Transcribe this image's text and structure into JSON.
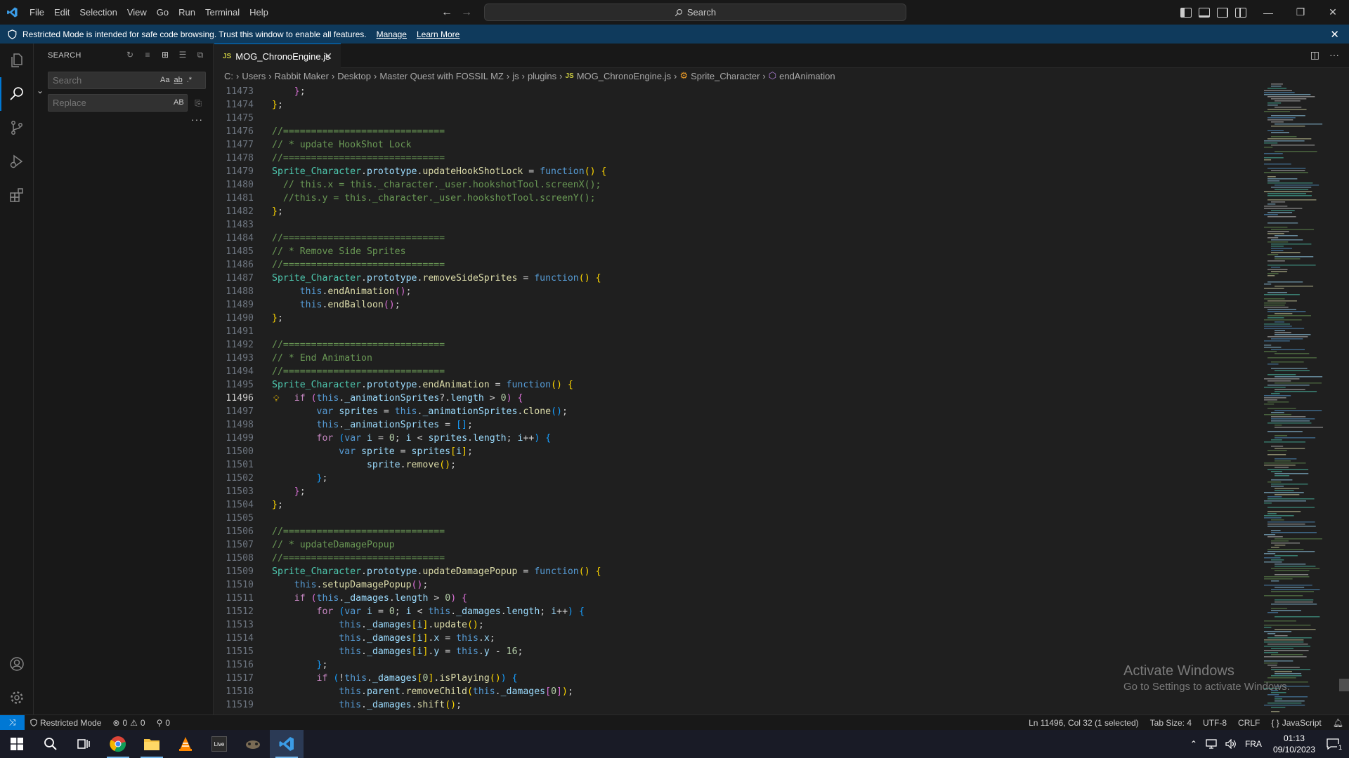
{
  "menu": [
    "File",
    "Edit",
    "Selection",
    "View",
    "Go",
    "Run",
    "Terminal",
    "Help"
  ],
  "title_search": "Search",
  "banner": {
    "text": "Restricted Mode is intended for safe code browsing. Trust this window to enable all features.",
    "manage": "Manage",
    "learn_more": "Learn More"
  },
  "sidebar": {
    "title": "SEARCH",
    "search_placeholder": "Search",
    "replace_placeholder": "Replace",
    "search_opts": [
      "Aa",
      "ab",
      ".*"
    ],
    "replace_opt": "AB"
  },
  "tab": {
    "label": "MOG_ChronoEngine.js",
    "badge": "JS"
  },
  "breadcrumb": [
    "C:",
    "Users",
    "Rabbit Maker",
    "Desktop",
    "Master Quest with FOSSIL MZ",
    "js",
    "plugins",
    "MOG_ChronoEngine.js",
    "Sprite_Character",
    "endAnimation"
  ],
  "editor": {
    "current_line": 11496,
    "lines": [
      {
        "n": 11473,
        "html": "    <span class='c-br2'>}</span>;"
      },
      {
        "n": 11474,
        "html": "<span class='c-br1'>}</span>;"
      },
      {
        "n": 11475,
        "html": ""
      },
      {
        "n": 11476,
        "html": "<span class='c-com'>//=============================</span>"
      },
      {
        "n": 11477,
        "html": "<span class='c-com'>// * update HookShot Lock</span>"
      },
      {
        "n": 11478,
        "html": "<span class='c-com'>//=============================</span>"
      },
      {
        "n": 11479,
        "html": "<span class='c-cls'>Sprite_Character</span>.<span class='c-var'>prototype</span>.<span class='c-fn'>updateHookShotLock</span> = <span class='c-kw'>function</span><span class='c-br1'>()</span> <span class='c-br1'>{</span>"
      },
      {
        "n": 11480,
        "html": "  <span class='c-com'>// this.x = this._character._user.hookshotTool.screenX();</span>"
      },
      {
        "n": 11481,
        "html": "  <span class='c-com'>//this.y = this._character._user.hookshotTool.screenY();</span>"
      },
      {
        "n": 11482,
        "html": "<span class='c-br1'>}</span>;"
      },
      {
        "n": 11483,
        "html": ""
      },
      {
        "n": 11484,
        "html": "<span class='c-com'>//=============================</span>"
      },
      {
        "n": 11485,
        "html": "<span class='c-com'>// * Remove Side Sprites</span>"
      },
      {
        "n": 11486,
        "html": "<span class='c-com'>//=============================</span>"
      },
      {
        "n": 11487,
        "html": "<span class='c-cls'>Sprite_Character</span>.<span class='c-var'>prototype</span>.<span class='c-fn'>removeSideSprites</span> = <span class='c-kw'>function</span><span class='c-br1'>()</span> <span class='c-br1'>{</span>"
      },
      {
        "n": 11488,
        "html": "     <span class='c-kw'>this</span>.<span class='c-fn'>endAnimation</span><span class='c-br2'>()</span>;"
      },
      {
        "n": 11489,
        "html": "     <span class='c-kw'>this</span>.<span class='c-fn'>endBalloon</span><span class='c-br2'>()</span>;"
      },
      {
        "n": 11490,
        "html": "<span class='c-br1'>}</span>;"
      },
      {
        "n": 11491,
        "html": ""
      },
      {
        "n": 11492,
        "html": "<span class='c-com'>//=============================</span>"
      },
      {
        "n": 11493,
        "html": "<span class='c-com'>// * End Animation</span>"
      },
      {
        "n": 11494,
        "html": "<span class='c-com'>//=============================</span>"
      },
      {
        "n": 11495,
        "html": "<span class='c-cls'>Sprite_Character</span>.<span class='c-var'>prototype</span>.<span class='c-fn'>endAnimation</span> = <span class='c-kw'>function</span><span class='c-br1'>()</span> <span class='c-br1'>{</span>"
      },
      {
        "n": 11496,
        "html": "    <span class='c-kw2'>if</span> <span class='c-br2'>(</span><span class='c-kw'>this</span>.<span class='c-var'>_animationSprites</span>?.<span class='c-var'>length</span> &gt; <span class='c-num'>0</span><span class='c-br2'>)</span> <span class='c-br2'>{</span>"
      },
      {
        "n": 11497,
        "html": "        <span class='c-kw'>var</span> <span class='c-var'>sprites</span> = <span class='c-kw'>this</span>.<span class='c-var'>_animationSprites</span>.<span class='c-fn'>clone</span><span class='c-br3'>()</span>;"
      },
      {
        "n": 11498,
        "html": "        <span class='c-kw'>this</span>.<span class='c-var'>_animationSprites</span> = <span class='c-br3'>[]</span>;"
      },
      {
        "n": 11499,
        "html": "        <span class='c-kw2'>for</span> <span class='c-br3'>(</span><span class='c-kw'>var</span> <span class='c-var'>i</span> = <span class='c-num'>0</span>; <span class='c-var'>i</span> &lt; <span class='c-var'>sprites</span>.<span class='c-var'>length</span>; <span class='c-var'>i</span>++<span class='c-br3'>)</span> <span class='c-br3'>{</span>"
      },
      {
        "n": 11500,
        "html": "            <span class='c-kw'>var</span> <span class='c-var'>sprite</span> = <span class='c-var'>sprites</span><span class='c-br1'>[</span><span class='c-var'>i</span><span class='c-br1'>]</span>;"
      },
      {
        "n": 11501,
        "html": "                 <span class='c-var'>sprite</span>.<span class='c-fn'>remove</span><span class='c-br1'>()</span>;"
      },
      {
        "n": 11502,
        "html": "        <span class='c-br3'>}</span>;"
      },
      {
        "n": 11503,
        "html": "    <span class='c-br2'>}</span>;"
      },
      {
        "n": 11504,
        "html": "<span class='c-br1'>}</span>;"
      },
      {
        "n": 11505,
        "html": ""
      },
      {
        "n": 11506,
        "html": "<span class='c-com'>//=============================</span>"
      },
      {
        "n": 11507,
        "html": "<span class='c-com'>// * updateDamagePopup</span>"
      },
      {
        "n": 11508,
        "html": "<span class='c-com'>//=============================</span>"
      },
      {
        "n": 11509,
        "html": "<span class='c-cls'>Sprite_Character</span>.<span class='c-var'>prototype</span>.<span class='c-fn'>updateDamagePopup</span> = <span class='c-kw'>function</span><span class='c-br1'>()</span> <span class='c-br1'>{</span>"
      },
      {
        "n": 11510,
        "html": "    <span class='c-kw'>this</span>.<span class='c-fn'>setupDamagePopup</span><span class='c-br2'>()</span>;"
      },
      {
        "n": 11511,
        "html": "    <span class='c-kw2'>if</span> <span class='c-br2'>(</span><span class='c-kw'>this</span>.<span class='c-var'>_damages</span>.<span class='c-var'>length</span> &gt; <span class='c-num'>0</span><span class='c-br2'>)</span> <span class='c-br2'>{</span>"
      },
      {
        "n": 11512,
        "html": "        <span class='c-kw2'>for</span> <span class='c-br3'>(</span><span class='c-kw'>var</span> <span class='c-var'>i</span> = <span class='c-num'>0</span>; <span class='c-var'>i</span> &lt; <span class='c-kw'>this</span>.<span class='c-var'>_damages</span>.<span class='c-var'>length</span>; <span class='c-var'>i</span>++<span class='c-br3'>)</span> <span class='c-br3'>{</span>"
      },
      {
        "n": 11513,
        "html": "            <span class='c-kw'>this</span>.<span class='c-var'>_damages</span><span class='c-br1'>[</span><span class='c-var'>i</span><span class='c-br1'>]</span>.<span class='c-fn'>update</span><span class='c-br1'>()</span>;"
      },
      {
        "n": 11514,
        "html": "            <span class='c-kw'>this</span>.<span class='c-var'>_damages</span><span class='c-br1'>[</span><span class='c-var'>i</span><span class='c-br1'>]</span>.<span class='c-var'>x</span> = <span class='c-kw'>this</span>.<span class='c-var'>x</span>;"
      },
      {
        "n": 11515,
        "html": "            <span class='c-kw'>this</span>.<span class='c-var'>_damages</span><span class='c-br1'>[</span><span class='c-var'>i</span><span class='c-br1'>]</span>.<span class='c-var'>y</span> = <span class='c-kw'>this</span>.<span class='c-var'>y</span> - <span class='c-num'>16</span>;"
      },
      {
        "n": 11516,
        "html": "        <span class='c-br3'>}</span>;"
      },
      {
        "n": 11517,
        "html": "        <span class='c-kw2'>if</span> <span class='c-br3'>(</span>!<span class='c-kw'>this</span>.<span class='c-var'>_damages</span><span class='c-br1'>[</span><span class='c-num'>0</span><span class='c-br1'>]</span>.<span class='c-fn'>isPlaying</span><span class='c-br1'>()</span><span class='c-br3'>)</span> <span class='c-br3'>{</span>"
      },
      {
        "n": 11518,
        "html": "            <span class='c-kw'>this</span>.<span class='c-var'>parent</span>.<span class='c-fn'>removeChild</span><span class='c-br1'>(</span><span class='c-kw'>this</span>.<span class='c-var'>_damages</span><span class='c-br2'>[</span><span class='c-num'>0</span><span class='c-br2'>]</span><span class='c-br1'>)</span>;"
      },
      {
        "n": 11519,
        "html": "            <span class='c-kw'>this</span>.<span class='c-var'>_damages</span>.<span class='c-fn'>shift</span><span class='c-br1'>()</span>;"
      }
    ]
  },
  "watermark": {
    "title": "Activate Windows",
    "subtitle": "Go to Settings to activate Windows."
  },
  "status": {
    "restricted": "Restricted Mode",
    "errors": "0",
    "warnings": "0",
    "ports": "0",
    "position": "Ln 11496, Col 32 (1 selected)",
    "tab_size": "Tab Size: 4",
    "encoding": "UTF-8",
    "eol": "CRLF",
    "language": "JavaScript"
  },
  "tray": {
    "lang": "FRA",
    "time": "01:13",
    "date": "09/10/2023",
    "notif_count": "1"
  },
  "colors": {
    "accent": "#0078d4",
    "banner": "#0f3a5c",
    "taskbar": "#191b26"
  }
}
